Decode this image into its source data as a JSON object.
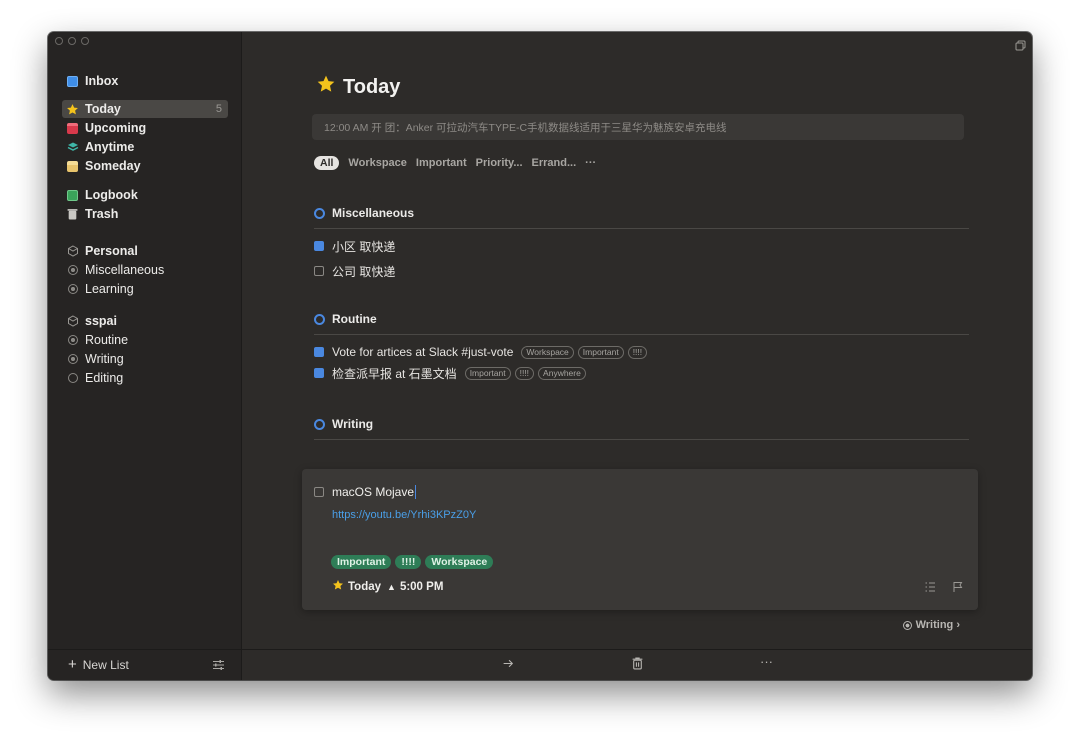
{
  "sidebar": {
    "groups": [
      [
        {
          "label": "Inbox",
          "icon": "inbox-icon"
        }
      ],
      [
        {
          "label": "Today",
          "icon": "star-icon",
          "count": "5",
          "selected": true
        },
        {
          "label": "Upcoming",
          "icon": "calendar-icon"
        },
        {
          "label": "Anytime",
          "icon": "layers-icon"
        },
        {
          "label": "Someday",
          "icon": "archive-box-icon"
        }
      ],
      [
        {
          "label": "Logbook",
          "icon": "logbook-icon"
        },
        {
          "label": "Trash",
          "icon": "trash-icon"
        }
      ]
    ],
    "areas": [
      {
        "label": "Personal",
        "icon": "area-cube-icon",
        "projects": [
          {
            "label": "Miscellaneous"
          },
          {
            "label": "Learning"
          }
        ]
      },
      {
        "label": "sspai",
        "icon": "area-cube-icon",
        "projects": [
          {
            "label": "Routine"
          },
          {
            "label": "Writing"
          },
          {
            "label": "Editing"
          }
        ]
      }
    ],
    "new_list_label": "New List"
  },
  "main": {
    "title": "Today",
    "quick_entry": "12:00 AM 开 团：Anker 可拉动汽车TYPE-C手机数据线适用于三星华为魅族安卓充电线",
    "filters": [
      "All",
      "Workspace",
      "Important",
      "Priority...",
      "Errand...",
      "···"
    ],
    "sections": [
      {
        "title": "Miscellaneous",
        "todos": [
          {
            "text": "小区 取快递",
            "checked": true,
            "tags": []
          },
          {
            "text": "公司 取快递",
            "checked": false,
            "tags": []
          }
        ]
      },
      {
        "title": "Routine",
        "todos": [
          {
            "text": "Vote for artices at Slack #just-vote",
            "checked": true,
            "tags": [
              "Workspace",
              "Important",
              "!!!!"
            ]
          },
          {
            "text": "检查派早报 at 石墨文档",
            "checked": true,
            "tags": [
              "Important",
              "!!!!",
              "Anywhere"
            ]
          }
        ]
      },
      {
        "title": "Writing",
        "todos": []
      }
    ],
    "detail": {
      "title": "macOS Mojave",
      "link": "https://youtu.be/Yrhi3KPzZ0Y",
      "tags": [
        "Important",
        "!!!!",
        "Workspace"
      ],
      "when": "Today",
      "reminder": "5:00 PM"
    },
    "move_to_label": "Writing ›"
  },
  "colors": {
    "accent": "#4a88e0",
    "tag_green": "#2e7d57",
    "link": "#4a9fe8",
    "bg": "#2d2b29",
    "sidebar_bg": "#262423"
  }
}
